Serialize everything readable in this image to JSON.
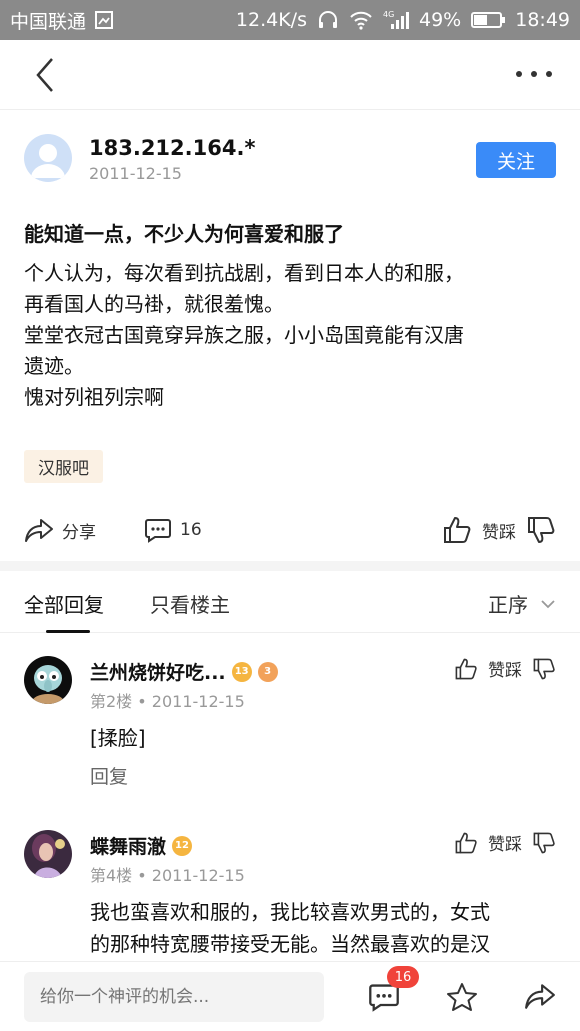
{
  "status_bar": {
    "carrier": "中国联通",
    "speed": "12.4K/s",
    "network": "4G",
    "battery": "49%",
    "time": "18:49"
  },
  "post": {
    "author": "183.212.164.*",
    "date": "2011-12-15",
    "follow_label": "关注",
    "title": "能知道一点，不少人为何喜爱和服了",
    "body_lines": [
      "个人认为，每次看到抗战剧，看到日本人的和服，",
      "再看国人的马褂，就很羞愧。",
      "堂堂衣冠古国竟穿异族之服，小小岛国竟能有汉唐",
      "遗迹。",
      "愧对列祖列宗啊"
    ],
    "forum_tag": "汉服吧",
    "share_label": "分享",
    "comment_count": "16",
    "vote_label": "赞踩"
  },
  "tabs": {
    "all_replies": "全部回复",
    "owner_only": "只看楼主",
    "sort": "正序"
  },
  "replies": [
    {
      "name": "兰州烧饼好吃...",
      "level": "13",
      "badge2": "3",
      "floor": "第2楼",
      "date": "2011-12-15",
      "content_lines": [
        "[揉脸]"
      ],
      "reply_label": "回复",
      "vote_label": "赞踩"
    },
    {
      "name": "蝶舞雨澈",
      "level": "12",
      "floor": "第4楼",
      "date": "2011-12-15",
      "content_lines": [
        "我也蛮喜欢和服的，我比较喜欢男式的，女式",
        "的那种特宽腰带接受无能。当然最喜欢的是汉"
      ],
      "vote_label": "赞踩"
    }
  ],
  "bottom": {
    "input_placeholder": "给你一个神评的机会...",
    "comment_badge": "16"
  },
  "colors": {
    "accent": "#3a8bf8",
    "badge_red": "#f0433a",
    "tag_bg": "#fbf1e4",
    "statusbar": "#8a8a8a"
  }
}
